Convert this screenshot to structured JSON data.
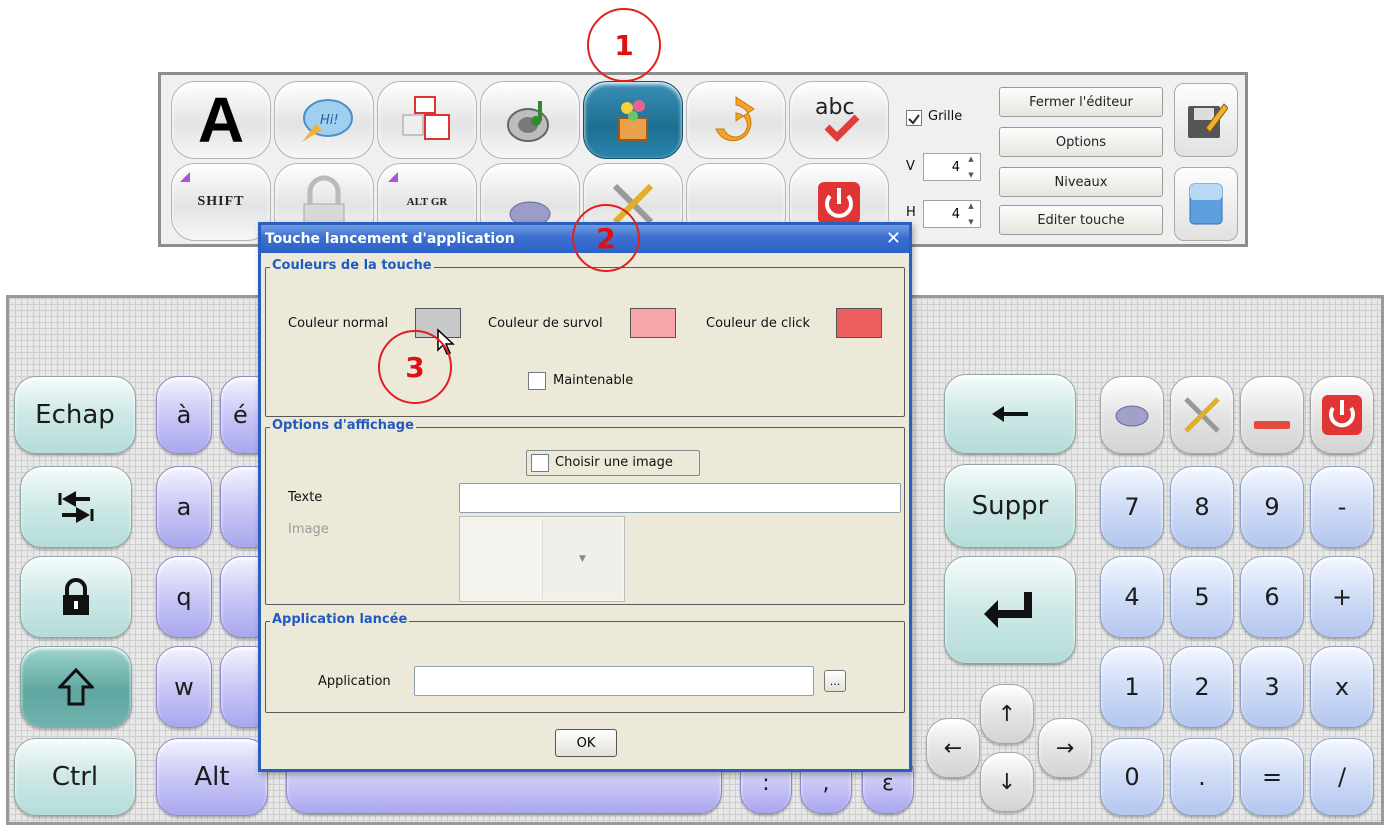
{
  "toolbar": {
    "checkbox_grille": {
      "label": "Grille",
      "checked": true
    },
    "v_label": "V",
    "h_label": "H",
    "v_value": "4",
    "h_value": "4",
    "buttons": {
      "fermer": "Fermer l'éditeur",
      "options": "Options",
      "niveaux": "Niveaux",
      "editer": "Editer touche"
    },
    "row1_labels": {
      "letter": "A",
      "abc": "abc"
    },
    "row2_labels": {
      "shift": "SHIFT",
      "altgr": "ALT GR"
    }
  },
  "annotations": [
    "1",
    "2",
    "3"
  ],
  "dialog": {
    "title": "Touche lancement d'application",
    "group_colors": {
      "title": "Couleurs de la touche",
      "normal_label": "Couleur normal",
      "survol_label": "Couleur de survol",
      "click_label": "Couleur de click",
      "normal_color": "#c8c8c8",
      "survol_color": "#f6a5a8",
      "click_color": "#ee5f62",
      "maintenable_label": "Maintenable",
      "maintenable_checked": false
    },
    "group_display": {
      "title": "Options d'affichage",
      "choose_image_label": "Choisir une image",
      "choose_image_checked": false,
      "texte_label": "Texte",
      "texte_value": "",
      "image_label": "Image"
    },
    "group_app": {
      "title": "Application lancée",
      "app_label": "Application",
      "app_value": "",
      "browse_label": "..."
    },
    "ok_label": "OK"
  },
  "keyboard": {
    "left_keys": {
      "echap": "Echap",
      "ctrl": "Ctrl",
      "alt": "Alt"
    },
    "letters": {
      "a_grave": "à",
      "e_acute": "é",
      "a": "a",
      "q": "q",
      "w": "w"
    },
    "right_keys": {
      "suppr": "Suppr"
    },
    "numpad": {
      "row1": [
        "7",
        "8",
        "9",
        "-"
      ],
      "row2": [
        "4",
        "5",
        "6",
        "+"
      ],
      "row3": [
        "1",
        "2",
        "3",
        "x"
      ],
      "row4": [
        "0",
        ".",
        "=",
        "/"
      ]
    },
    "arrows": {
      "up": "↑",
      "down": "↓",
      "left": "←",
      "right": "→"
    },
    "bottom_partial": {
      "colon": ":",
      "comma": ",",
      "e_partial": "ε"
    },
    "colors": {
      "teal": "#cde8e6",
      "purple": "#c9c8f5",
      "blue": "#cfdcf6",
      "red": "#d93434"
    }
  }
}
